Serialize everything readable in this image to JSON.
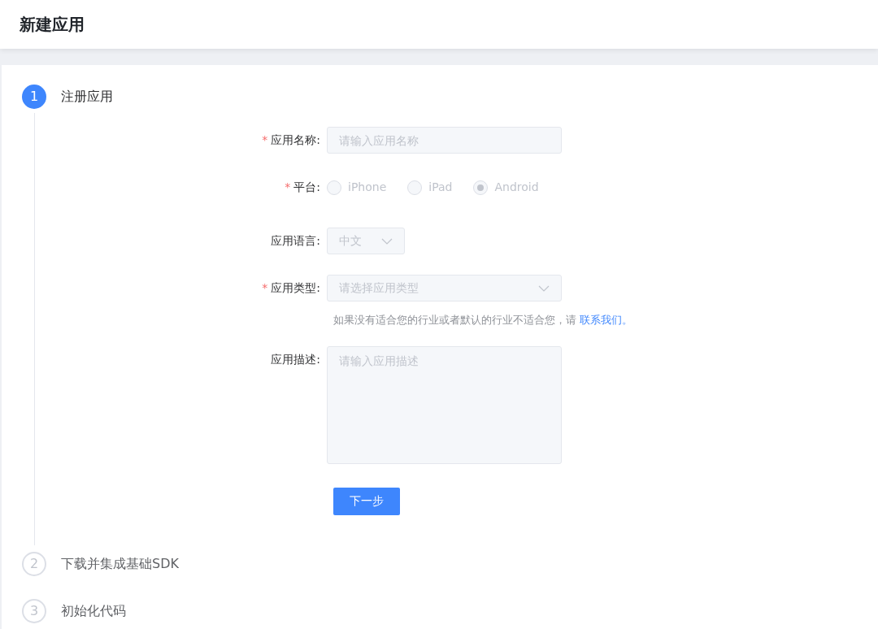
{
  "header": {
    "title": "新建应用"
  },
  "steps": [
    {
      "number": "1",
      "label": "注册应用",
      "active": true
    },
    {
      "number": "2",
      "label": "下载并集成基础SDK",
      "active": false
    },
    {
      "number": "3",
      "label": "初始化代码",
      "active": false
    }
  ],
  "form": {
    "name": {
      "label": "应用名称:",
      "required_mark": "*",
      "placeholder": "请输入应用名称"
    },
    "platform": {
      "label": "平台:",
      "required_mark": "*",
      "disabled": true,
      "options": [
        {
          "label": "iPhone",
          "selected": false
        },
        {
          "label": "iPad",
          "selected": false
        },
        {
          "label": "Android",
          "selected": true
        }
      ]
    },
    "language": {
      "label": "应用语言:",
      "value": "中文"
    },
    "type": {
      "label": "应用类型:",
      "required_mark": "*",
      "placeholder": "请选择应用类型"
    },
    "hint": {
      "text": "如果没有适合您的行业或者默认的行业不适合您，请",
      "link": "联系我们",
      "suffix": "。"
    },
    "description": {
      "label": "应用描述:",
      "placeholder": "请输入应用描述"
    },
    "submit": "下一步"
  }
}
